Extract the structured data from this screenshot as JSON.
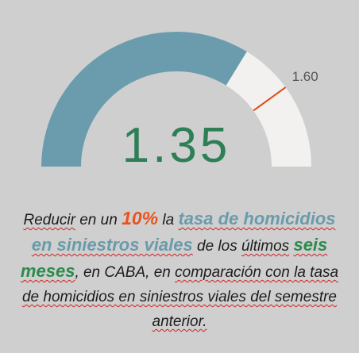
{
  "gauge": {
    "value": 1.35,
    "value_text": "1.35",
    "target": 1.6,
    "target_text": "1.60",
    "range": [
      0,
      2
    ],
    "colors": {
      "fill": "#6b9cad",
      "track": "#f2f1f0",
      "target_line": "#e04a10",
      "value_text": "#2e7f56",
      "target_text": "#555555",
      "background": "#cfcfcf"
    }
  },
  "description": {
    "part1": "Reducir",
    "part2": " en un ",
    "pct": "10%",
    "part3": " la ",
    "highlight1": "tasa de homicidios en siniestros viales",
    "part4": " de los ",
    "part5": "últimos",
    "part6": " ",
    "highlight2": "seis meses",
    "part7": ", en CABA, en ",
    "part8": "comparación con la tasa de homicidios en siniestros viales del semestre anterior."
  }
}
